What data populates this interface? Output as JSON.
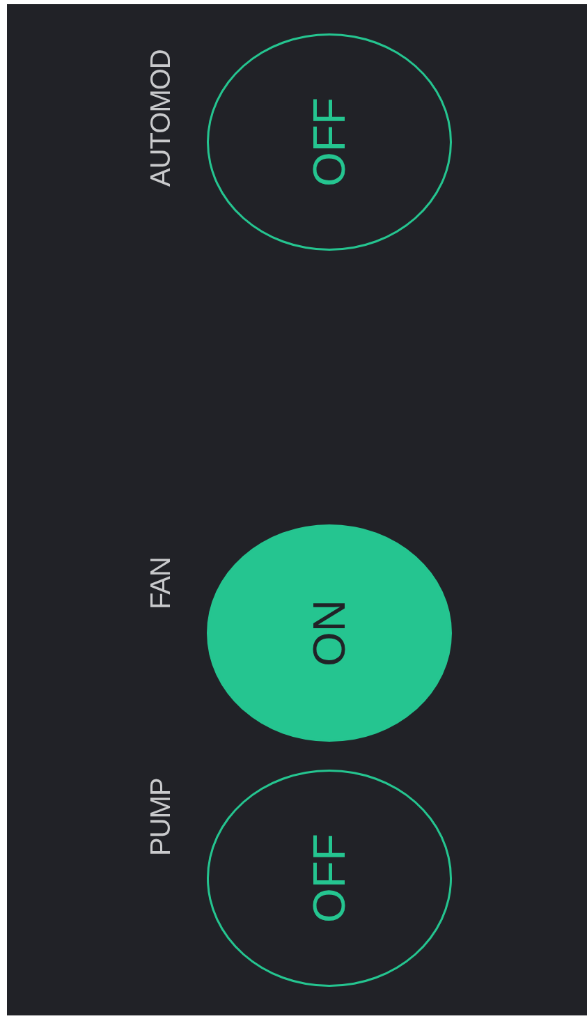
{
  "widgets": [
    {
      "label": "AUTOMOD",
      "state_text": "OFF",
      "on": false
    },
    {
      "label": "FAN",
      "state_text": "ON",
      "on": true
    },
    {
      "label": "PUMP",
      "state_text": "OFF",
      "on": false
    }
  ]
}
